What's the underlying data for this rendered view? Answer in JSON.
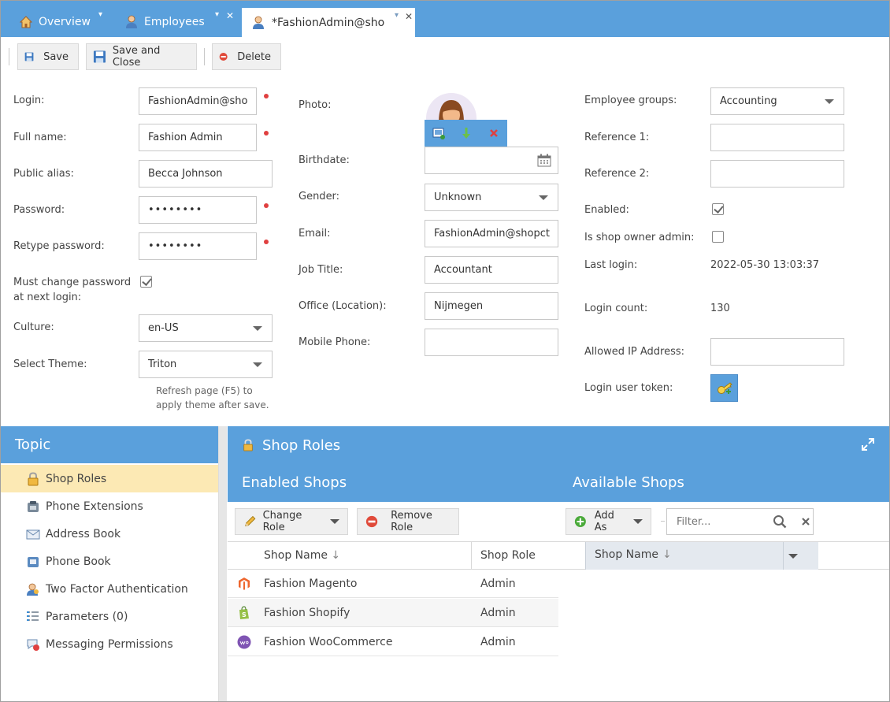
{
  "tabs": [
    {
      "label": "Overview",
      "icon": "home-icon"
    },
    {
      "label": "Employees",
      "icon": "employee-icon"
    },
    {
      "label": "*FashionAdmin@sho",
      "icon": "employee-icon"
    }
  ],
  "toolbar": {
    "save_label": "Save",
    "save_close_label": "Save and Close",
    "delete_label": "Delete"
  },
  "form": {
    "login_label": "Login:",
    "login_value": "FashionAdmin@sho",
    "fullname_label": "Full name:",
    "fullname_value": "Fashion Admin",
    "alias_label": "Public alias:",
    "alias_value": "Becca Johnson",
    "password_label": "Password:",
    "password_value": "••••••••",
    "retype_label": "Retype password:",
    "retype_value": "••••••••",
    "mustchange_label_1": "Must change password",
    "mustchange_label_2": "at next login:",
    "culture_label": "Culture:",
    "culture_value": "en-US",
    "theme_label": "Select Theme:",
    "theme_value": "Triton",
    "theme_hint_1": "Refresh page (F5) to",
    "theme_hint_2": "apply theme after save.",
    "photo_label": "Photo:",
    "birthdate_label": "Birthdate:",
    "birthdate_value": "",
    "gender_label": "Gender:",
    "gender_value": "Unknown",
    "email_label": "Email:",
    "email_value": "FashionAdmin@shopct",
    "job_label": "Job Title:",
    "job_value": "Accountant",
    "office_label": "Office (Location):",
    "office_value": "Nijmegen",
    "mobile_label": "Mobile Phone:",
    "mobile_value": "",
    "groups_label": "Employee groups:",
    "groups_value": "Accounting",
    "ref1_label": "Reference 1:",
    "ref1_value": "",
    "ref2_label": "Reference 2:",
    "ref2_value": "",
    "enabled_label": "Enabled:",
    "shopowner_label": "Is shop owner admin:",
    "lastlogin_label": "Last login:",
    "lastlogin_value": "2022-05-30 13:03:37",
    "logincount_label": "Login count:",
    "logincount_value": "130",
    "allowedip_label": "Allowed IP Address:",
    "allowedip_value": "",
    "token_label": "Login user token:"
  },
  "topic": {
    "title": "Topic",
    "items": [
      {
        "label": "Shop Roles",
        "icon": "lock-icon"
      },
      {
        "label": "Phone Extensions",
        "icon": "phone-extension-icon"
      },
      {
        "label": "Address Book",
        "icon": "envelope-icon"
      },
      {
        "label": "Phone Book",
        "icon": "phone-book-icon"
      },
      {
        "label": "Two Factor Authentication",
        "icon": "two-factor-icon"
      },
      {
        "label": "Parameters (0)",
        "icon": "parameters-icon"
      },
      {
        "label": "Messaging Permissions",
        "icon": "messaging-icon"
      }
    ]
  },
  "roles": {
    "title": "Shop Roles",
    "enabled_title": "Enabled Shops",
    "available_title": "Available Shops",
    "change_role_label": "Change Role",
    "remove_role_label": "Remove Role",
    "add_as_label": "Add As",
    "filter_placeholder": "Filter...",
    "columns": {
      "shop_name": "Shop Name",
      "shop_role": "Shop Role",
      "available_shop_name": "Shop Name"
    },
    "rows": [
      {
        "name": "Fashion Magento",
        "role": "Admin",
        "icon": "magento-icon"
      },
      {
        "name": "Fashion Shopify",
        "role": "Admin",
        "icon": "shopify-icon"
      },
      {
        "name": "Fashion WooCommerce",
        "role": "Admin",
        "icon": "woocommerce-icon"
      }
    ]
  },
  "colors": {
    "accent": "#5aa0dc",
    "selection": "#fce9b4",
    "required": "#e04040"
  }
}
